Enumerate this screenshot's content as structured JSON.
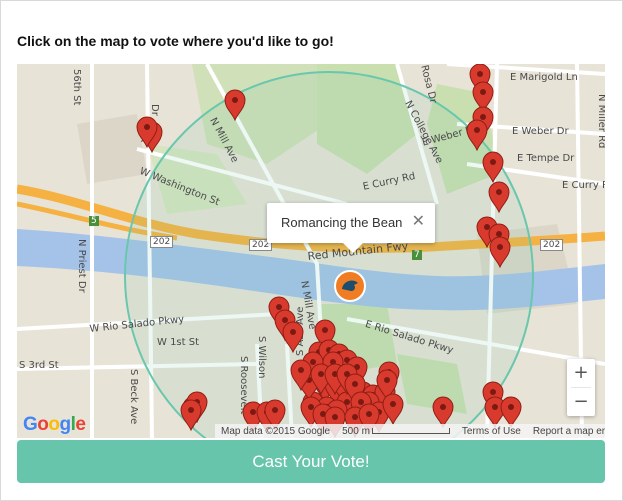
{
  "instruction": "Click on the map to vote where you'd like to go!",
  "map": {
    "popup": {
      "title": "Romancing the Bean",
      "close": "✕"
    },
    "zoom": {
      "in": "+",
      "out": "−"
    },
    "logo": {
      "text": "Google",
      "letters": [
        "G",
        "o",
        "o",
        "g",
        "l",
        "e"
      ],
      "colors": [
        "#4285F4",
        "#EA4335",
        "#FBBC05",
        "#4285F4",
        "#34A853",
        "#EA4335"
      ]
    },
    "attribution": {
      "map_data": "Map data ©2015 Google",
      "scale": "500 m",
      "terms": "Terms of Use",
      "report": "Report a map error"
    },
    "street_labels": {
      "s56": "56th St",
      "mill": "N Mill Ave",
      "washington": "W Washington St",
      "curry": "E Curry Rd",
      "redmtn": "Red Mountain Fwy",
      "r202a": "202",
      "r202b": "202",
      "r202c": "202",
      "r5": "5",
      "r7": "7",
      "priest": "N Priest Dr",
      "riosalado_w": "W Rio Salado Pkwy",
      "riosalado_e": "E Rio Salado Pkwy",
      "first": "W 1st St",
      "s3rd": "S 3rd St",
      "beck": "S Beck Ave",
      "roosevelt": "S Roosevelt",
      "wilson": "S Wilson",
      "ash": "S Ash Ave",
      "college": "N College Ave",
      "weber": "E Weber Dr",
      "weber2": "E Weber Dr",
      "marigold": "E Marigold Ln",
      "tempe": "E Tempe Dr",
      "curry2": "E Curry Rd",
      "miller": "N Miller Rd",
      "rosa": "Rosa Dr",
      "n_dr": "Dr",
      "a_lbl": "A"
    },
    "colors": {
      "water": "#a5c3e8",
      "park": "#c9dfb0",
      "land": "#e8e3d7",
      "freeway": "#f5b243",
      "circle": "#68c7ad",
      "pin": "#d93a2e",
      "marker": "#f07d24"
    }
  },
  "vote_button": "Cast Your Vote!"
}
